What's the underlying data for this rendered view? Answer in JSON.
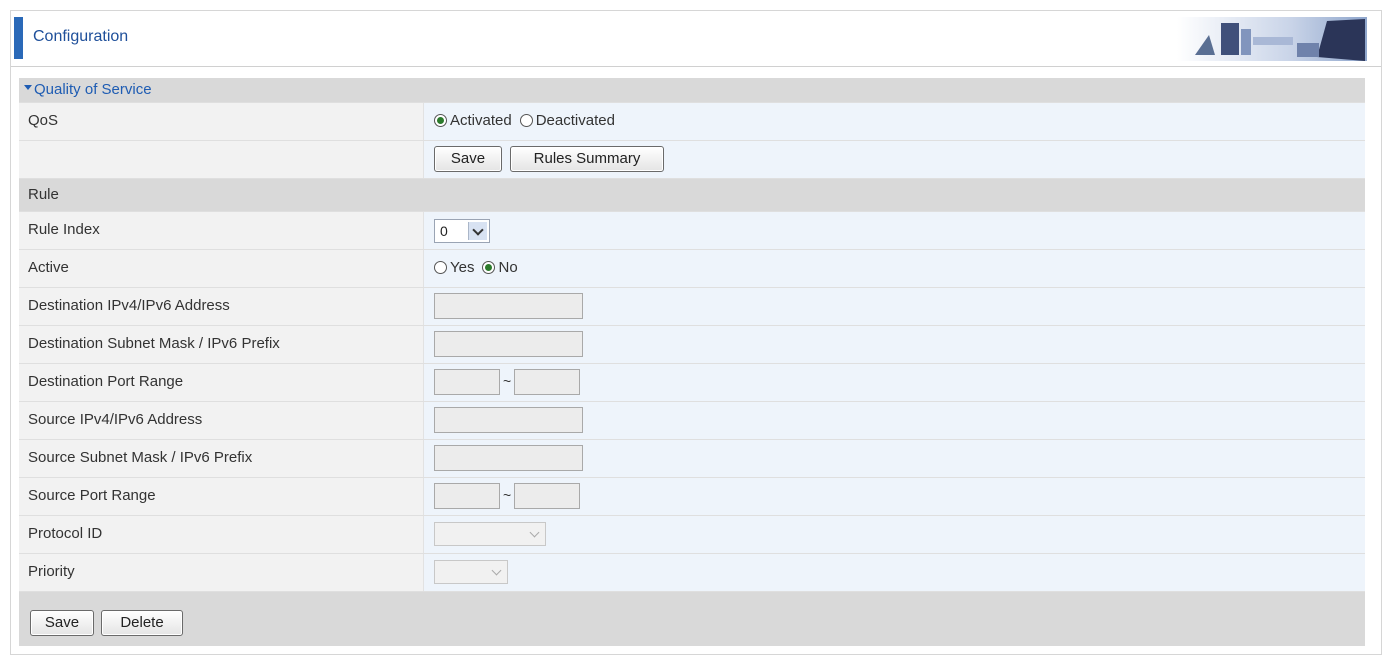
{
  "header": {
    "title": "Configuration"
  },
  "section": {
    "title": "Quality of Service"
  },
  "qos": {
    "label": "QoS",
    "options": [
      "Activated",
      "Deactivated"
    ],
    "selected": "Activated",
    "save_label": "Save",
    "summary_label": "Rules Summary"
  },
  "rule": {
    "title": "Rule",
    "index_label": "Rule Index",
    "index_value": "0",
    "active_label": "Active",
    "active_options": [
      "Yes",
      "No"
    ],
    "active_selected": "No",
    "dest_ip_label": "Destination IPv4/IPv6 Address",
    "dest_mask_label": "Destination Subnet Mask / IPv6 Prefix",
    "dest_port_label": "Destination Port Range",
    "src_ip_label": "Source IPv4/IPv6 Address",
    "src_mask_label": "Source Subnet Mask / IPv6 Prefix",
    "src_port_label": "Source Port Range",
    "protocol_label": "Protocol ID",
    "priority_label": "Priority",
    "range_separator": "~"
  },
  "footer": {
    "save_label": "Save",
    "delete_label": "Delete"
  },
  "colors": {
    "accent": "#2a69b8",
    "link": "#1e5cb3",
    "label_bg": "#f2f2f2",
    "value_bg": "#eef4fb",
    "section_bg": "#d9d9d9"
  }
}
